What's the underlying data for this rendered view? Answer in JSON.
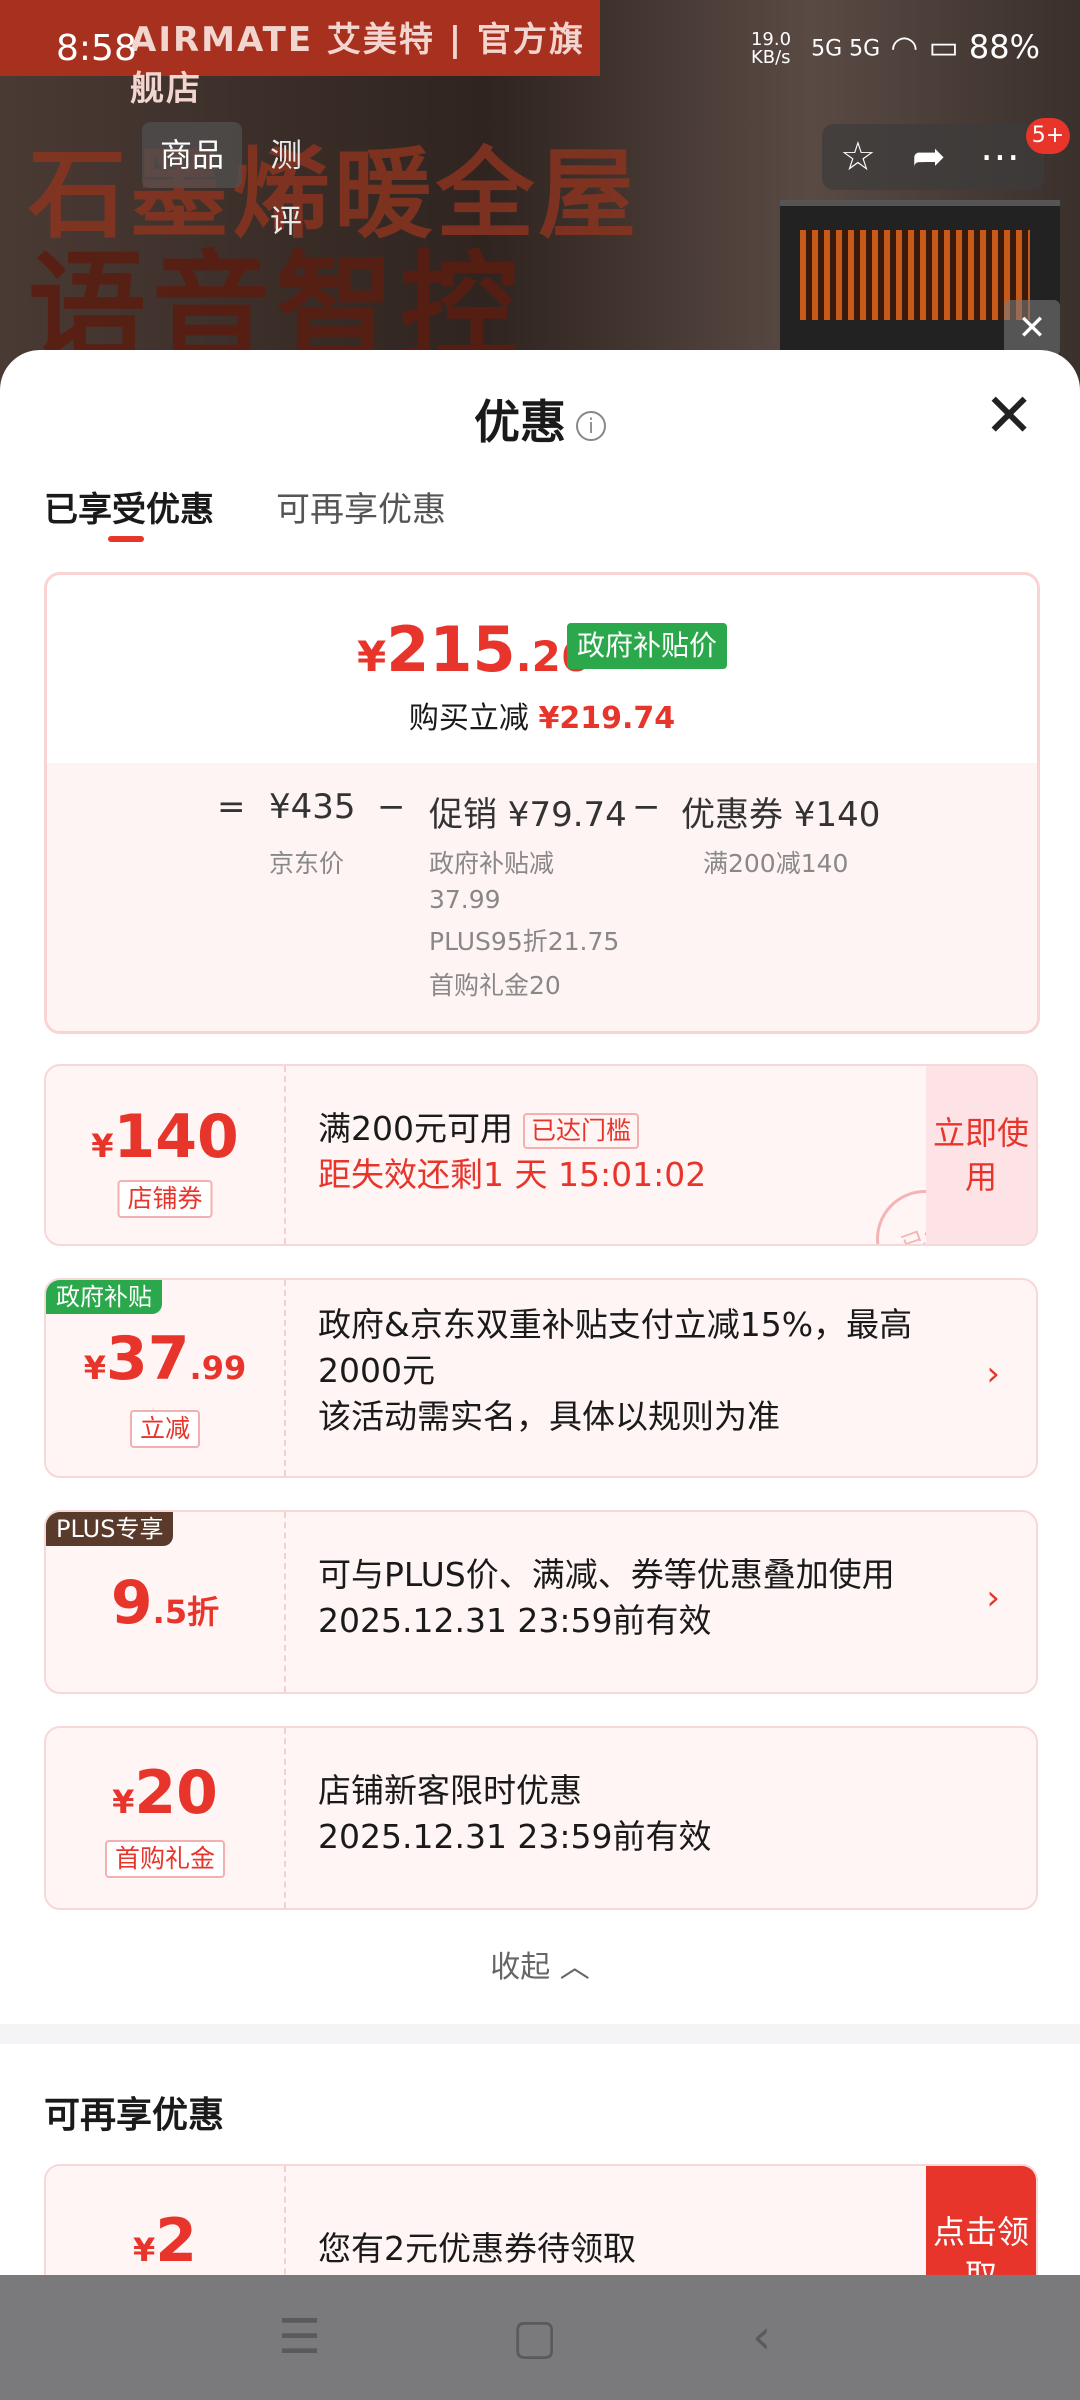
{
  "status_bar": {
    "time": "8:58",
    "net_speed": "19.0 KB/s",
    "signal": "5G 5G",
    "battery": "88%"
  },
  "banner": {
    "brand": "AIRMATE 艾美特 | 官方旗舰店",
    "headline1": "石墨烯暖全屋",
    "headline2": "语音智控"
  },
  "top_tabs": {
    "goods": "商品",
    "review": "测评",
    "more_badge": "5+"
  },
  "sheet": {
    "title": "优惠",
    "tabs": [
      "已享受优惠",
      "可再享优惠"
    ],
    "summary": {
      "currency": "¥",
      "price_int": "215",
      "price_dec": ".26",
      "gov_tag": "政府补贴价",
      "buy_label": "购买立减",
      "buy_amount": "¥219.74",
      "eq": "=",
      "jd_price": "¥435",
      "jd_price_label": "京东价",
      "minus1": "−",
      "promo": "促销 ¥79.74",
      "promo_lines": [
        "政府补贴减",
        "37.99",
        "PLUS95折21.75",
        "首购礼金20"
      ],
      "minus2": "−",
      "coupon": "优惠券 ¥140",
      "coupon_line": "满200减140"
    },
    "cards": [
      {
        "y": "¥",
        "amount": "140",
        "dec": "",
        "tag": "店铺券",
        "line1": "满200元可用",
        "badge": "已达门槛",
        "line2": "距失效还剩1 天 15:01:02",
        "action": "立即使用",
        "stamp": "已领"
      },
      {
        "corner": "政府补贴",
        "y": "¥",
        "amount": "37",
        "dec": ".99",
        "tag": "立减",
        "line1": "政府&京东双重补贴支付立减15%，最高",
        "line1b": "2000元",
        "line2": "该活动需实名，具体以规则为准",
        "arrow": "›"
      },
      {
        "corner": "PLUS专享",
        "amount": "9",
        "dec": ".5折",
        "line1": "可与PLUS价、满减、券等优惠叠加使用",
        "line2": "2025.12.31 23:59前有效",
        "arrow": "›"
      },
      {
        "y": "¥",
        "amount": "20",
        "dec": "",
        "tag": "首购礼金",
        "line1": "店铺新客限时优惠",
        "line2": "2025.12.31 23:59前有效"
      }
    ],
    "collapse": "收起 ︿",
    "more_title": "可再享优惠",
    "more_card": {
      "y": "¥",
      "amount": "2",
      "line1": "您有2元优惠券待领取",
      "action": "点击领取"
    }
  },
  "colors": {
    "accent": "#e8352b",
    "gov_green": "#2aa84b",
    "plus_brown": "#5a3a2a"
  }
}
